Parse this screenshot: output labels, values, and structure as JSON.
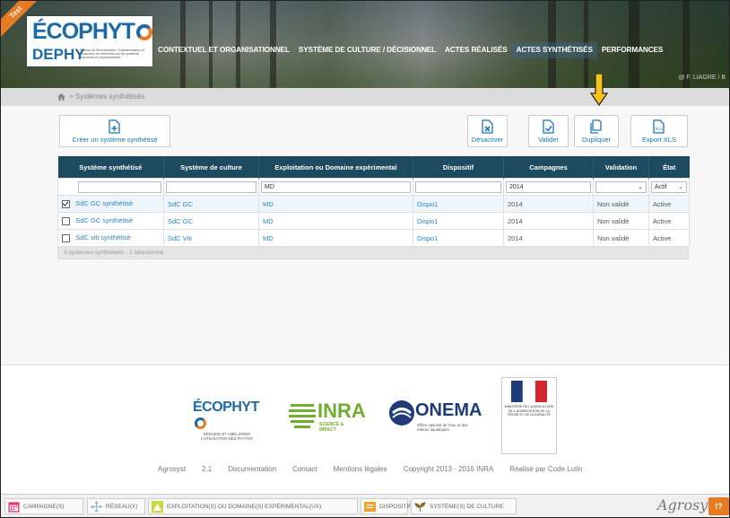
{
  "header": {
    "test_ribbon": "Test",
    "logo": {
      "line1": "ÉCOPHYT",
      "line2": "DEPHY",
      "tagline": "Réseau de Démonstration, Expérimentation et Production de références sur les systèmes économes en phytosanitaires"
    },
    "nav": [
      {
        "label": "CONTEXTUEL ET ORGANISATIONNEL",
        "active": false
      },
      {
        "label": "SYSTÈME DE CULTURE / DÉCISIONNEL",
        "active": false
      },
      {
        "label": "ACTES RÉALISÉS",
        "active": false
      },
      {
        "label": "ACTES SYNTHÉTISÉS",
        "active": true
      },
      {
        "label": "PERFORMANCES",
        "active": false
      }
    ],
    "photo_credit": "@ F. LIAGRE / B"
  },
  "breadcrumb": {
    "text": "> Systèmes synthétisés"
  },
  "toolbar": {
    "create": "Créer un système synthétisé",
    "deactivate": "Désactiver",
    "validate": "Valider",
    "duplicate": "Dupliquer",
    "export": "Export XLS"
  },
  "table": {
    "columns": [
      "Système synthétisé",
      "Système de culture",
      "Exploitation ou Domaine expérimental",
      "Dispositif",
      "Campagnes",
      "Validation",
      "État"
    ],
    "filters": {
      "system": "",
      "sdc": "",
      "domain": "MD",
      "dispositif": "",
      "campaign": "2014",
      "validation": "",
      "state": "Actif"
    },
    "rows": [
      {
        "checked": true,
        "system": "SdC GC synthétisé",
        "sdc": "SdC GC",
        "domain": "MD",
        "dispositif": "Dispo1",
        "campaign": "2014",
        "validation": "Non validé",
        "state": "Active"
      },
      {
        "checked": false,
        "system": "SdC GC synthétisé",
        "sdc": "SdC GC",
        "domain": "MD",
        "dispositif": "Dispo1",
        "campaign": "2014",
        "validation": "Non validé",
        "state": "Active"
      },
      {
        "checked": false,
        "system": "SdC viti synthétisé",
        "sdc": "SdC Viti",
        "domain": "MD",
        "dispositif": "Dispo1",
        "campaign": "2014",
        "validation": "Non validé",
        "state": "Active"
      }
    ],
    "footer": "3 systèmes synthétisés - 1 sélectionné"
  },
  "footer": {
    "logos": {
      "ecophyto": "ÉCOPHYT",
      "ecophyto_tag": "RÉDUIRE ET AMÉLIORER L'UTILISATION DES PHYTOS",
      "inra": "INRA",
      "inra_tag": "SCIENCE & IMPACT",
      "onema": "ONEMA",
      "onema_tag": "Office national de l'eau et des milieux aquatiques",
      "ministry": "MINISTÈRE DE L'AGRICULTURE DE L'ALIMENTATION DE LA PÊCHE ET DE LA RURALITÉ"
    },
    "links": [
      "Agrosyst",
      "2.1",
      "Documentation",
      "Contact",
      "Mentions légales",
      "Copyright 2013 - 2016 INRA",
      "Réalisé par Code Lutin"
    ]
  },
  "bottombar": {
    "items": [
      "CAMPAGNE(S)",
      "RÉSEAU(X)",
      "EXPLOITATION(S) OU DOMAINE(S) EXPÉRIMENTAL(UX)",
      "DISPOSITIF(S)",
      "SYSTÈME(S) DE CULTURE"
    ],
    "brand": "Agrosyst",
    "help": "!?"
  },
  "colors": {
    "header_dark": "#1d4a5f",
    "link": "#2a86c8",
    "accent": "#e87a22",
    "brand_blue": "#1a6aa8"
  }
}
